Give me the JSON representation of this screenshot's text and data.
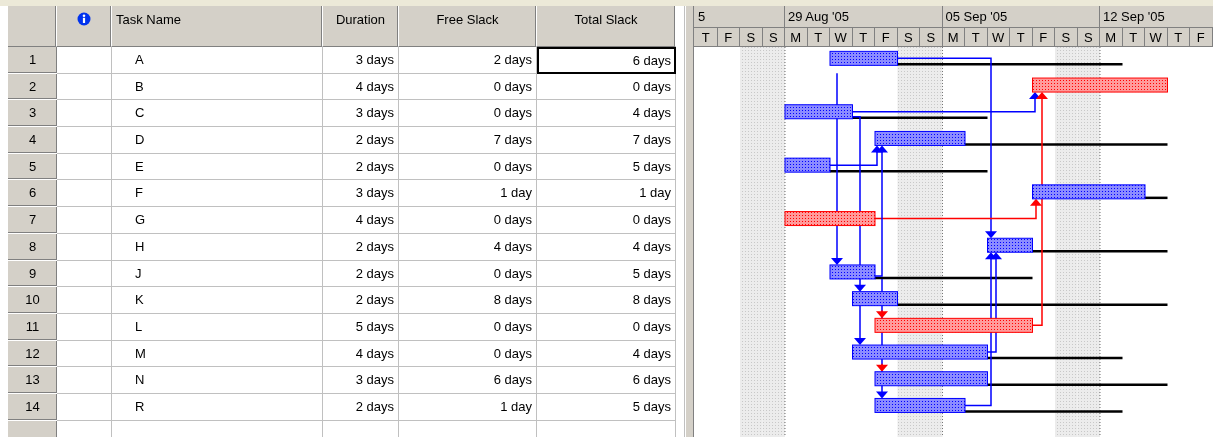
{
  "table": {
    "columns": [
      "Task Name",
      "Duration",
      "Free Slack",
      "Total Slack"
    ],
    "rows": [
      {
        "id": "1",
        "name": "A",
        "duration": "3 days",
        "free_slack": "2 days",
        "total_slack": "6 days",
        "selected": true,
        "critical": false
      },
      {
        "id": "2",
        "name": "B",
        "duration": "4 days",
        "free_slack": "0 days",
        "total_slack": "0 days",
        "selected": false,
        "critical": true
      },
      {
        "id": "3",
        "name": "C",
        "duration": "3 days",
        "free_slack": "0 days",
        "total_slack": "4 days",
        "selected": false,
        "critical": false
      },
      {
        "id": "4",
        "name": "D",
        "duration": "2 days",
        "free_slack": "7 days",
        "total_slack": "7 days",
        "selected": false,
        "critical": false
      },
      {
        "id": "5",
        "name": "E",
        "duration": "2 days",
        "free_slack": "0 days",
        "total_slack": "5 days",
        "selected": false,
        "critical": false
      },
      {
        "id": "6",
        "name": "F",
        "duration": "3 days",
        "free_slack": "1 day",
        "total_slack": "1 day",
        "selected": false,
        "critical": false
      },
      {
        "id": "7",
        "name": "G",
        "duration": "4 days",
        "free_slack": "0 days",
        "total_slack": "0 days",
        "selected": false,
        "critical": true
      },
      {
        "id": "8",
        "name": "H",
        "duration": "2 days",
        "free_slack": "4 days",
        "total_slack": "4 days",
        "selected": false,
        "critical": false
      },
      {
        "id": "9",
        "name": "J",
        "duration": "2 days",
        "free_slack": "0 days",
        "total_slack": "5 days",
        "selected": false,
        "critical": false
      },
      {
        "id": "10",
        "name": "K",
        "duration": "2 days",
        "free_slack": "8 days",
        "total_slack": "8 days",
        "selected": false,
        "critical": false
      },
      {
        "id": "11",
        "name": "L",
        "duration": "5 days",
        "free_slack": "0 days",
        "total_slack": "0 days",
        "selected": false,
        "critical": true
      },
      {
        "id": "12",
        "name": "M",
        "duration": "4 days",
        "free_slack": "0 days",
        "total_slack": "4 days",
        "selected": false,
        "critical": false
      },
      {
        "id": "13",
        "name": "N",
        "duration": "3 days",
        "free_slack": "6 days",
        "total_slack": "6 days",
        "selected": false,
        "critical": false
      },
      {
        "id": "14",
        "name": "R",
        "duration": "2 days",
        "free_slack": "1 day",
        "total_slack": "5 days",
        "selected": false,
        "critical": false
      }
    ]
  },
  "timescale": {
    "weeks": [
      "5",
      "29 Aug '05",
      "05 Sep '05",
      "12 Sep '05"
    ],
    "days": [
      {
        "label": "T",
        "weekend": false
      },
      {
        "label": "F",
        "weekend": false
      },
      {
        "label": "S",
        "weekend": true
      },
      {
        "label": "S",
        "weekend": true
      },
      {
        "label": "M",
        "weekend": false
      },
      {
        "label": "T",
        "weekend": false
      },
      {
        "label": "W",
        "weekend": false
      },
      {
        "label": "T",
        "weekend": false
      },
      {
        "label": "F",
        "weekend": false
      },
      {
        "label": "S",
        "weekend": true
      },
      {
        "label": "S",
        "weekend": true
      },
      {
        "label": "M",
        "weekend": false
      },
      {
        "label": "T",
        "weekend": false
      },
      {
        "label": "W",
        "weekend": false
      },
      {
        "label": "T",
        "weekend": false
      },
      {
        "label": "F",
        "weekend": false
      },
      {
        "label": "S",
        "weekend": true
      },
      {
        "label": "S",
        "weekend": true
      },
      {
        "label": "M",
        "weekend": false
      },
      {
        "label": "T",
        "weekend": false
      },
      {
        "label": "W",
        "weekend": false
      },
      {
        "label": "T",
        "weekend": false
      },
      {
        "label": "F",
        "weekend": false
      }
    ]
  }
}
